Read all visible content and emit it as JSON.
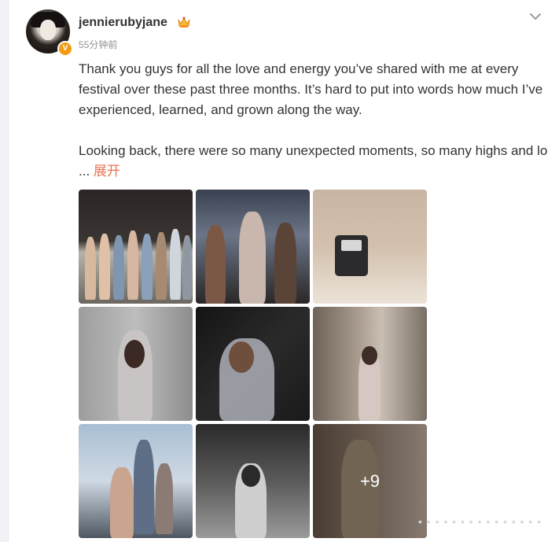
{
  "post": {
    "username": "jennierubyjane",
    "verified_badge": "V",
    "time_ago": "55分钟前",
    "text_p1": "Thank you guys for all the love and energy you’ve shared with me at every festival over these past three months. It’s hard to put into words how much I’ve experienced, learned, and grown along the way.",
    "text_p2": "Looking back, there were so many unexpected moments, so many highs and lo ",
    "ellipsis": "...",
    "expand_label": "展开",
    "more_photos": "+9",
    "colors": {
      "accent": "#eb7350",
      "badge": "#f39c12"
    }
  },
  "icons": [
    "chevron-down-icon",
    "crown-icon",
    "verified-icon"
  ]
}
